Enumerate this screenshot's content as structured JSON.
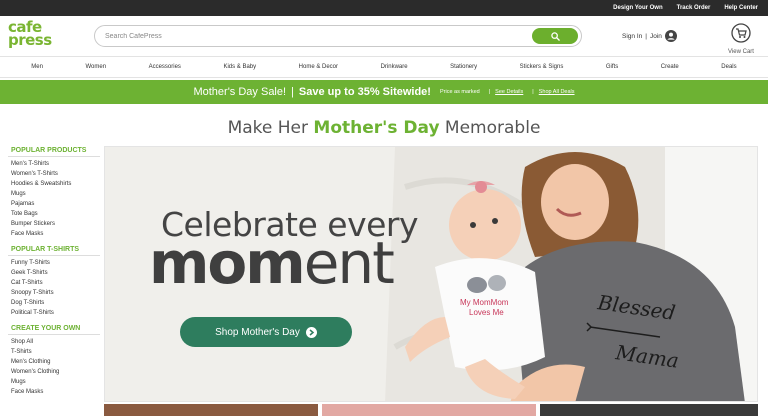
{
  "topbar": {
    "links": [
      "Design Your Own",
      "Track Order",
      "Help Center"
    ]
  },
  "header": {
    "logo_line1": "cafe",
    "logo_line2": "press",
    "search_placeholder": "Search CafePress",
    "sign_in": "Sign In",
    "divider": "|",
    "join": "Join",
    "cart_label": "View Cart"
  },
  "nav": {
    "items": [
      "Men",
      "Women",
      "Accessories",
      "Kids & Baby",
      "Home & Decor",
      "Drinkware",
      "Stationery",
      "Stickers & Signs",
      "Gifts",
      "Create",
      "Deals"
    ]
  },
  "promo": {
    "sale": "Mother's Day Sale!",
    "separator": "|",
    "offer": "Save up to 35% Sitewide!",
    "price_note": "Price as marked",
    "see_details": "See Details",
    "shop_all": "Shop All Deals"
  },
  "headline": {
    "pre": "Make Her ",
    "highlight": "Mother's Day",
    "post": " Memorable"
  },
  "sidebar": {
    "groups": [
      {
        "title": "POPULAR PRODUCTS",
        "items": [
          "Men's T-Shirts",
          "Women's T-Shirts",
          "Hoodies & Sweatshirts",
          "Mugs",
          "Pajamas",
          "Tote Bags",
          "Bumper Stickers",
          "Face Masks"
        ]
      },
      {
        "title": "POPULAR T-SHIRTS",
        "items": [
          "Funny T-Shirts",
          "Geek T-Shirts",
          "Cat T-Shirts",
          "Snoopy T-Shirts",
          "Dog T-Shirts",
          "Political T-Shirts"
        ]
      },
      {
        "title": "CREATE YOUR OWN",
        "items": [
          "Shop All",
          "T-Shirts",
          "Men's Clothing",
          "Women's Clothing",
          "Mugs",
          "Face Masks"
        ]
      }
    ]
  },
  "hero": {
    "line1": "Celebrate every",
    "line2_bold": "mom",
    "line2_rest": "ent",
    "button": "Shop Mother's Day",
    "baby_shirt_line1": "My MomMom",
    "baby_shirt_line2": "Loves Me",
    "mom_shirt_line1": "Blessed",
    "mom_shirt_line2": "Mama"
  },
  "colors": {
    "brand_green": "#6db233",
    "hero_button": "#2e7d5e",
    "topbar": "#2b2b2b"
  }
}
